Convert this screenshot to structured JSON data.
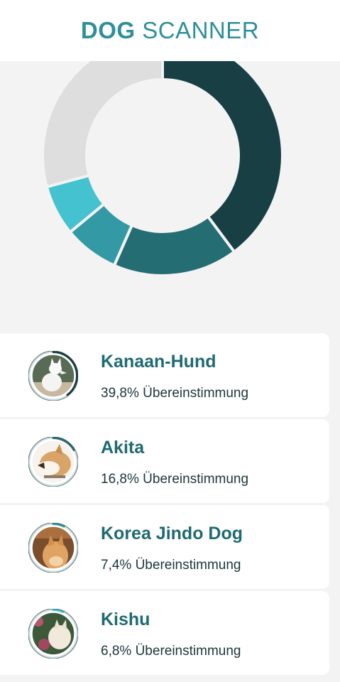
{
  "header": {
    "title_bold": "DOG",
    "title_regular": "SCANNER"
  },
  "colors": {
    "accent": "#2e8f9a",
    "remainder": "#dedede"
  },
  "chart_data": {
    "type": "pie",
    "variant": "donut",
    "categories": [
      "Kanaan-Hund",
      "Akita",
      "Korea Jindo Dog",
      "Kishu",
      "Rest"
    ],
    "values": [
      39.8,
      16.8,
      7.4,
      6.8,
      29.2
    ],
    "unit": "%",
    "colors": [
      "#173f44",
      "#246e73",
      "#3399a4",
      "#44c2cf",
      "#dedede"
    ]
  },
  "results": [
    {
      "name": "Kanaan-Hund",
      "match": "39,8% Übereinstimmung",
      "percent": 39.8,
      "ring_color": "#173f44",
      "photo_icon": "white-dog-photo-icon"
    },
    {
      "name": "Akita",
      "match": "16,8% Übereinstimmung",
      "percent": 16.8,
      "ring_color": "#246e73",
      "photo_icon": "akita-dog-photo-icon"
    },
    {
      "name": "Korea Jindo Dog",
      "match": "7,4% Übereinstimmung",
      "percent": 7.4,
      "ring_color": "#3399a4",
      "photo_icon": "jindo-dog-photo-icon"
    },
    {
      "name": "Kishu",
      "match": "6,8% Übereinstimmung",
      "percent": 6.8,
      "ring_color": "#44c2cf",
      "photo_icon": "kishu-dog-photo-icon"
    }
  ]
}
